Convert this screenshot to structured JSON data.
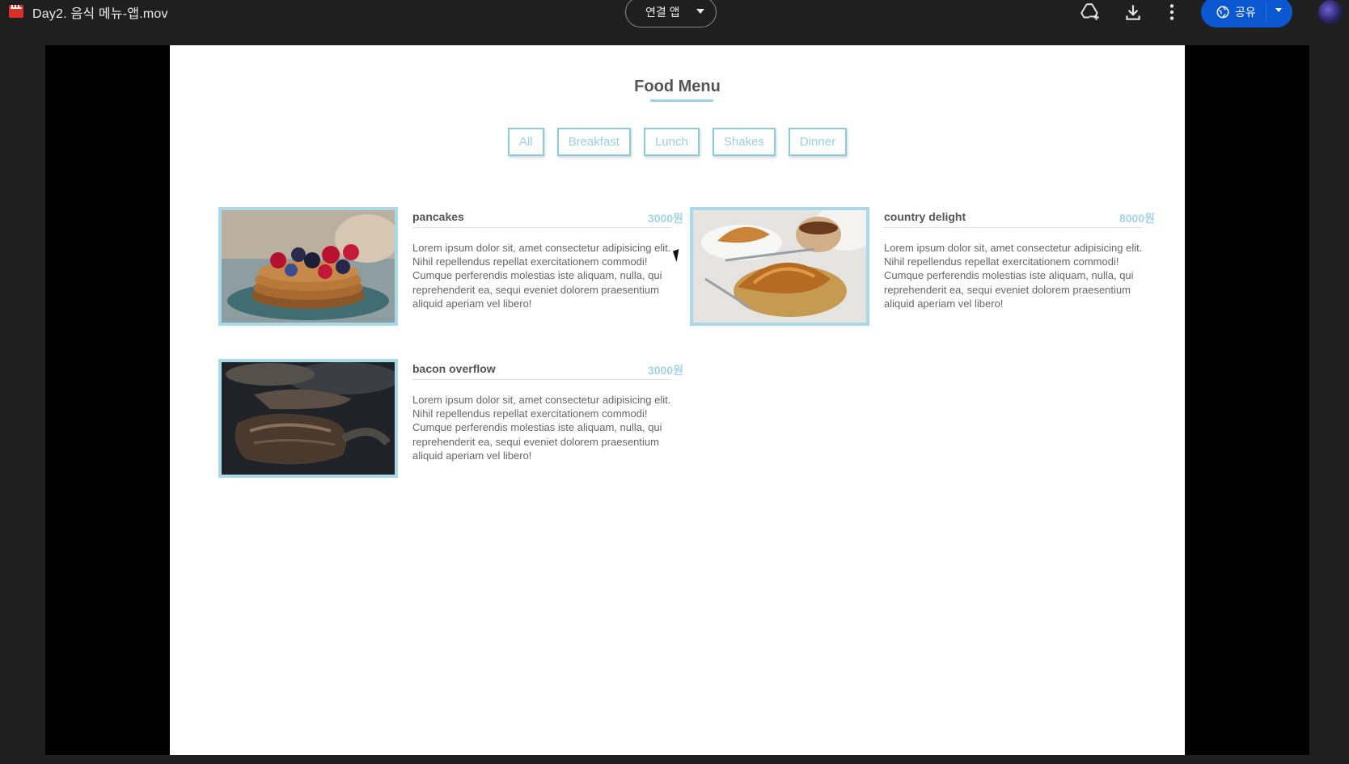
{
  "topbar": {
    "file_title": "Day2. 음식 메뉴-앱.mov",
    "open_app_label": "연결 앱",
    "share_label": "공유",
    "icons": [
      "add-to-drive-icon",
      "download-icon",
      "more-vert-icon",
      "globe-icon"
    ]
  },
  "page": {
    "title": "Food Menu",
    "filters": [
      "All",
      "Breakfast",
      "Lunch",
      "Shakes",
      "Dinner"
    ],
    "items": [
      {
        "name": "pancakes",
        "price": "3000원",
        "description": "Lorem ipsum dolor sit, amet consectetur adipisicing elit. Nihil repellendus repellat exercitationem commodi! Cumque perferendis molestias iste aliquam, nulla, qui reprehenderit ea, sequi eveniet dolorem praesentium aliquid aperiam vel libero!"
      },
      {
        "name": "country delight",
        "price": "8000원",
        "description": "Lorem ipsum dolor sit, amet consectetur adipisicing elit. Nihil repellendus repellat exercitationem commodi! Cumque perferendis molestias iste aliquam, nulla, qui reprehenderit ea, sequi eveniet dolorem praesentium aliquid aperiam vel libero!"
      },
      {
        "name": "bacon overflow",
        "price": "3000원",
        "description": "Lorem ipsum dolor sit, amet consectetur adipisicing elit. Nihil repellendus repellat exercitationem commodi! Cumque perferendis molestias iste aliquam, nulla, qui reprehenderit ea, sequi eveniet dolorem praesentium aliquid aperiam vel libero!"
      }
    ]
  },
  "colors": {
    "accent": "#a9d9e8",
    "share_button": "#0b57d0",
    "background": "#1f1f1f"
  }
}
